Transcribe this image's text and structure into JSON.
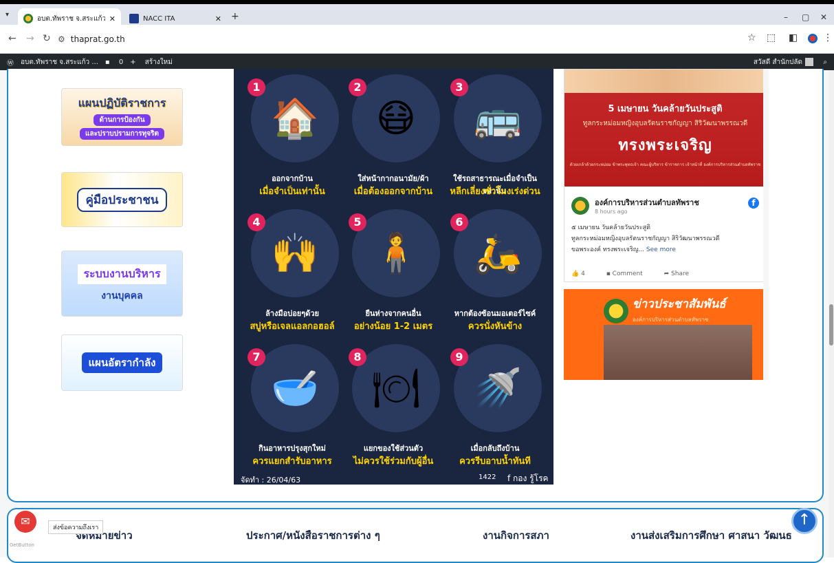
{
  "browser": {
    "tabs": [
      {
        "title": "อบต.ทัพราช จ.สระแก้ว – ยินดีต้อนรับ",
        "active": true
      },
      {
        "title": "NACC ITA",
        "active": false
      }
    ],
    "url": "thaprat.go.th"
  },
  "wp_admin_bar": {
    "site": "อบต.ทัพราช จ.สระแก้ว ...",
    "comments": "0",
    "new": "สร้างใหม่",
    "greeting": "สวัสดี สำนักปลัด"
  },
  "left_banners": [
    {
      "line1": "แผนปฏิบัติราชการ",
      "line2": "ด้านการป้องกัน",
      "line3": "และปราบปรามการทุจริต"
    },
    {
      "line1": "คู่มือประชาชน"
    },
    {
      "line1": "ระบบงานบริหาร",
      "line2": "งานบุคคล"
    },
    {
      "line1": "แผนอัตรากำลัง"
    }
  ],
  "infographic": {
    "items": [
      {
        "num": "1",
        "icon": "house-icon",
        "glyph": "🏠",
        "line1": "ออกจากบ้าน",
        "line2": "เมื่อจำเป็นเท่านั้น"
      },
      {
        "num": "2",
        "icon": "mask-icon",
        "glyph": "😷",
        "line1": "ใส่หน้ากากอนามัย/ผ้า",
        "line2": "เมื่อต้องออกจากบ้าน"
      },
      {
        "num": "3",
        "icon": "bus-icon",
        "glyph": "🚌",
        "line1": "ใช้รถสาธารณะเมื่อจำเป็นเท่านั้น",
        "line2": "หลีกเลี่ยงชั่วโมงเร่งด่วน"
      },
      {
        "num": "4",
        "icon": "handwash-icon",
        "glyph": "🙌",
        "line1": "ล้างมือบ่อยๆด้วย",
        "line2": "สบู่หรือเจลแอลกอฮอล์"
      },
      {
        "num": "5",
        "icon": "distance-icon",
        "glyph": "🧍",
        "line1": "ยืนห่างจากคนอื่น",
        "line2": "อย่างน้อย 1-2 เมตร"
      },
      {
        "num": "6",
        "icon": "motorbike-icon",
        "glyph": "🛵",
        "line1": "หากต้องซ้อนมอเตอร์ไซค์",
        "line2": "ควรนั่งหันข้าง"
      },
      {
        "num": "7",
        "icon": "bowl-icon",
        "glyph": "🥣",
        "line1": "กินอาหารปรุงสุกใหม่",
        "line2": "ควรแยกสำรับอาหาร"
      },
      {
        "num": "8",
        "icon": "cutlery-icon",
        "glyph": "🍽",
        "line1": "แยกของใช้ส่วนตัว",
        "line2": "ไม่ควรใช้ร่วมกับผู้อื่น"
      },
      {
        "num": "9",
        "icon": "shower-icon",
        "glyph": "🚿",
        "line1": "เมื่อกลับถึงบ้าน",
        "line2": "ควรรีบอาบน้ำทันที"
      }
    ],
    "date": "จัดทำ : 26/04/63",
    "hotline": "1422",
    "ddc": "f กอง รู้โรค"
  },
  "facebook_post": {
    "image_h1": "5 เมษายน วันคล้ายวันประสูติ",
    "image_h2": "ทูลกระหม่อมหญิงอุบลรัตนราชกัญญา สิริวัฒนาพรรณวดี",
    "image_h3": "ทรงพระเจริญ",
    "image_h4": "ด้วยเกล้าด้วยกระหม่อม ข้าพระพุทธเจ้า คณะผู้บริหาร ข้าราชการ เจ้าหน้าที่ องค์การบริหารส่วนตำบลทัพราช",
    "page_name": "องค์การบริหารส่วนตำบลทัพราช",
    "time": "8 hours ago",
    "text_line1": "๕ เมษายน วันคล้ายวันประสูติ",
    "text_line2": "ทูลกระหม่อมหญิงอุบลรัตนราชกัญญา สิริวัฒนาพรรณวดี",
    "text_line3": "ขอพระองค์ ทรงพระเจริญ...",
    "see_more": "See more",
    "likes": "4",
    "comment": "Comment",
    "share": "Share"
  },
  "news_banner": {
    "title": "ข่าวประชาสัมพันธ์",
    "subtitle": "องค์การบริหารส่วนตำบลทัพราช"
  },
  "bottom_nav": [
    "จดหมายข่าว",
    "ประกาศ/หนังสือราชการต่าง ๆ",
    "งานกิจการสภา",
    "งานส่งเสริมการศึกษา ศาสนา วัฒนธ"
  ],
  "get_button": {
    "tooltip": "ส่งข้อความถึงเรา",
    "label": "GetButton"
  },
  "colors": {
    "accent": "#1e88c8",
    "info_bg": "#1a2540",
    "yellow": "#ffd400",
    "number": "#e0245e"
  }
}
